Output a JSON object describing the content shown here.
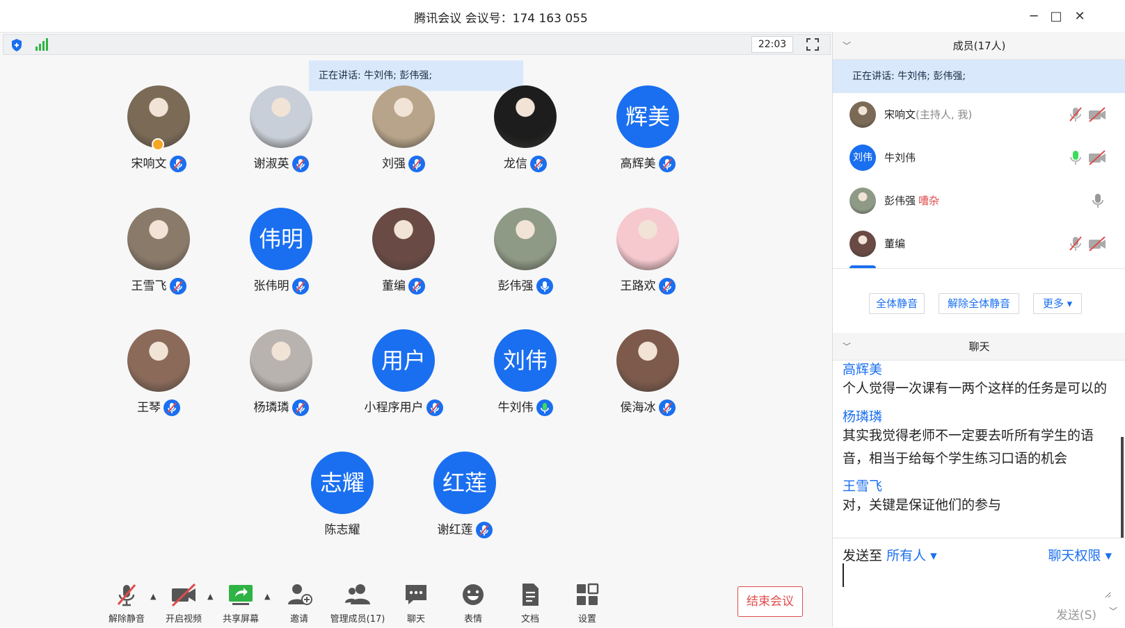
{
  "window": {
    "title": "腾讯会议 会议号：174 163 055",
    "minimize": "─",
    "maximize": "□",
    "close": "✕"
  },
  "main": {
    "timer": "22:03",
    "speaking_banner": "正在讲话: 牛刘伟; 彭伟强;",
    "participants": [
      {
        "name": "宋响文",
        "avatar_text": "",
        "photo_color": "#7b6a56"
      },
      {
        "name": "谢淑英",
        "avatar_text": "",
        "photo_color": "#c9cfd8"
      },
      {
        "name": "刘强",
        "avatar_text": "",
        "photo_color": "#b8a48a"
      },
      {
        "name": "龙信",
        "avatar_text": "",
        "photo_color": "#1d1d1d"
      },
      {
        "name": "高辉美",
        "avatar_text": "辉美",
        "photo_color": ""
      },
      {
        "name": "王雪飞",
        "avatar_text": "",
        "photo_color": "#8a7a6a"
      },
      {
        "name": "张伟明",
        "avatar_text": "伟明",
        "photo_color": ""
      },
      {
        "name": "董编",
        "avatar_text": "",
        "photo_color": "#6a4a44"
      },
      {
        "name": "彭伟强",
        "avatar_text": "",
        "photo_color": "#8e9a86"
      },
      {
        "name": "王路欢",
        "avatar_text": "",
        "photo_color": "#f6c9cf"
      },
      {
        "name": "王琴",
        "avatar_text": "",
        "photo_color": "#8b6a5a"
      },
      {
        "name": "杨璘璘",
        "avatar_text": "",
        "photo_color": "#b9b3b0"
      },
      {
        "name": "小程序用户",
        "avatar_text": "用户",
        "photo_color": ""
      },
      {
        "name": "牛刘伟",
        "avatar_text": "刘伟",
        "photo_color": ""
      },
      {
        "name": "侯海冰",
        "avatar_text": "",
        "photo_color": "#7d5a4c"
      },
      {
        "name": "陈志耀",
        "avatar_text": "志耀",
        "photo_color": ""
      },
      {
        "name": "谢红莲",
        "avatar_text": "红莲",
        "photo_color": ""
      }
    ]
  },
  "toolbar": {
    "unmute": "解除静音",
    "start_video": "开启视频",
    "share_screen": "共享屏幕",
    "invite": "邀请",
    "manage_members": "管理成员(17)",
    "chat": "聊天",
    "emoji": "表情",
    "docs": "文档",
    "settings": "设置",
    "end_meeting": "结束会议"
  },
  "members_panel": {
    "title": "成员(17人)",
    "speaking": "正在讲话: 牛刘伟; 彭伟强;",
    "members": [
      {
        "name": "宋响文",
        "role": "(主持人, 我)",
        "status": "",
        "avatar_text": ""
      },
      {
        "name": "牛刘伟",
        "role": "",
        "status": "",
        "avatar_text": "刘伟"
      },
      {
        "name": "彭伟强",
        "role": "",
        "status": "嘈杂",
        "avatar_text": ""
      },
      {
        "name": "董编",
        "role": "",
        "status": "",
        "avatar_text": ""
      }
    ],
    "mute_all": "全体静音",
    "unmute_all": "解除全体静音",
    "more": "更多 ▾"
  },
  "chat_panel": {
    "title": "聊天",
    "messages": [
      {
        "sender": "高辉美",
        "text": "个人觉得一次课有一两个这样的任务是可以的"
      },
      {
        "sender": "杨璘璘",
        "text": "其实我觉得老师不一定要去听所有学生的语音，相当于给每个学生练习口语的机会"
      },
      {
        "sender": "王雪飞",
        "text": "对，关键是保证他们的参与"
      }
    ],
    "send_to_label": "发送至",
    "send_to_target": "所有人 ▾",
    "permission": "聊天权限 ▾",
    "send": "发送(S)"
  },
  "colors": {
    "accent": "#1a6ff0",
    "danger": "#e04b4b",
    "speaking_bg": "#d9e8fb"
  }
}
